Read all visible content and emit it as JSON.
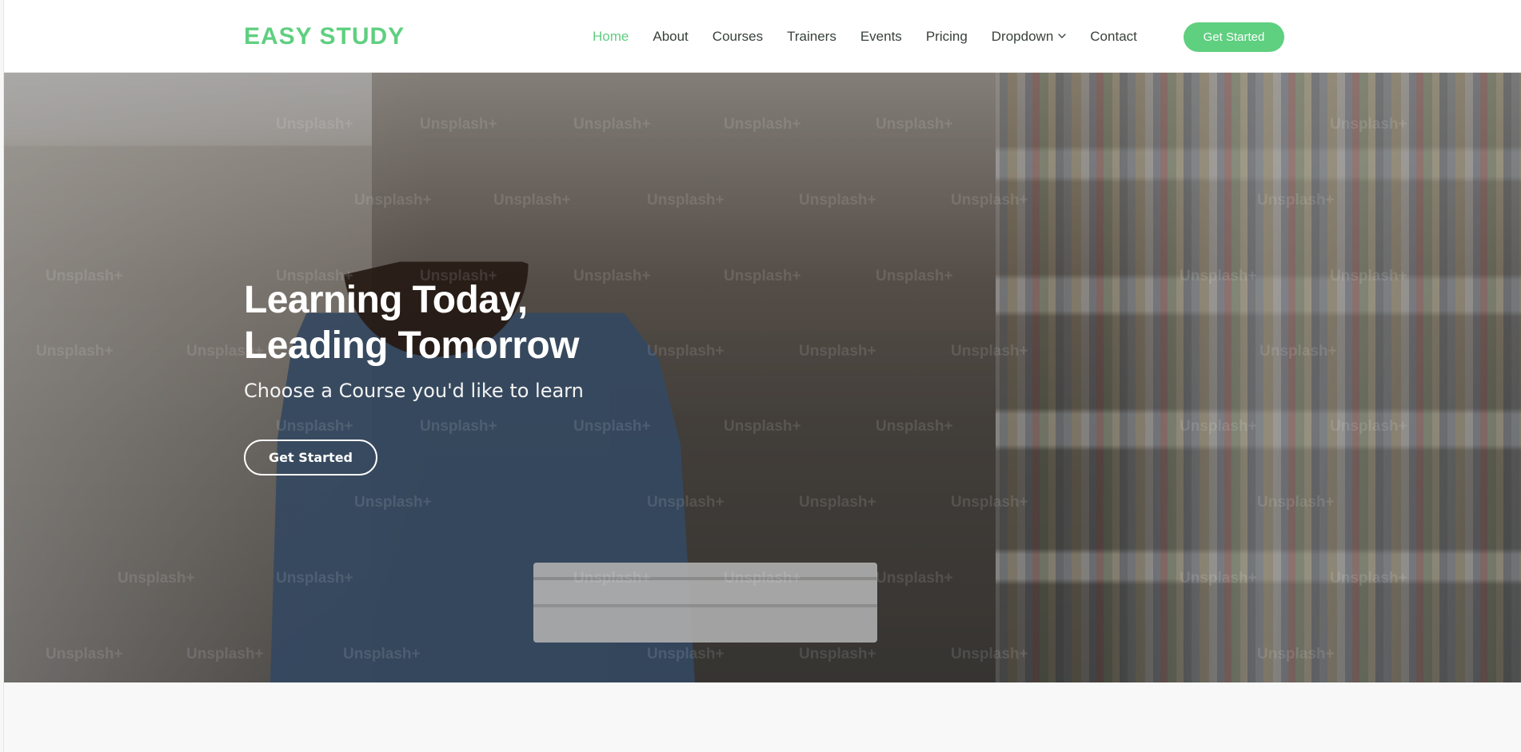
{
  "brand": {
    "logo_text": "EASY STUDY",
    "accent_color": "#5fcf80"
  },
  "nav": {
    "items": [
      {
        "label": "Home"
      },
      {
        "label": "About"
      },
      {
        "label": "Courses"
      },
      {
        "label": "Trainers"
      },
      {
        "label": "Events"
      },
      {
        "label": "Pricing"
      },
      {
        "label": "Dropdown"
      },
      {
        "label": "Contact"
      }
    ],
    "active": "Home",
    "cta_label": "Get Started",
    "dropdown_icon": "chevron-down-icon"
  },
  "hero": {
    "title_line_1": "Learning Today,",
    "title_line_2": "Leading Tomorrow",
    "subtitle": "Choose a Course you'd like to learn",
    "button_label": "Get Started",
    "watermark_text": "Unsplash+"
  }
}
